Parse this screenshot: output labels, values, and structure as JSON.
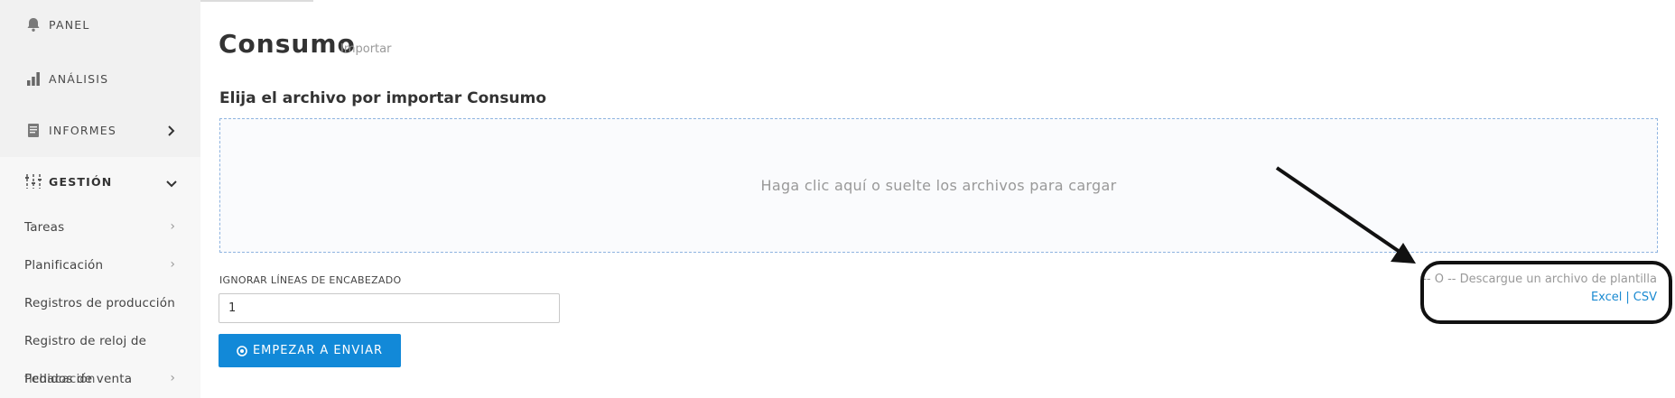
{
  "sidebar": {
    "items": [
      {
        "label": "PANEL",
        "icon": "bell-icon"
      },
      {
        "label": "ANÁLISIS",
        "icon": "bar-chart-icon"
      },
      {
        "label": "INFORMES",
        "icon": "document-icon",
        "chevron": "right"
      },
      {
        "label": "GESTIÓN",
        "icon": "sliders-icon",
        "chevron": "down",
        "active": true
      }
    ],
    "sub_items": [
      {
        "label": "Tareas",
        "chevron": "›"
      },
      {
        "label": "Planificación",
        "chevron": "›"
      },
      {
        "label": "Registros de producción"
      },
      {
        "label": "Registro de reloj de"
      },
      {
        "label": "Pedidos de venta",
        "chevron": "›"
      },
      {
        "label": "fichacación"
      }
    ]
  },
  "page": {
    "title": "Consumo",
    "subtitle": "Importar",
    "section_title": "Elija el archivo por importar Consumo",
    "dropzone_text": "Haga clic aquí o suelte los archivos para cargar",
    "header_lines_label": "IGNORAR LÍNEAS DE ENCABEZADO",
    "header_lines_value": "1",
    "submit_label": "EMPEZAR A ENVIAR",
    "template_text": "-- O -- Descargue un archivo de plantilla",
    "template_excel": "Excel",
    "template_separator": "|",
    "template_csv": "CSV"
  },
  "colors": {
    "accent": "#1289d8",
    "link": "#1a8ad1",
    "sidebar_bg": "#f1f1f1",
    "annotation": "#111111"
  }
}
